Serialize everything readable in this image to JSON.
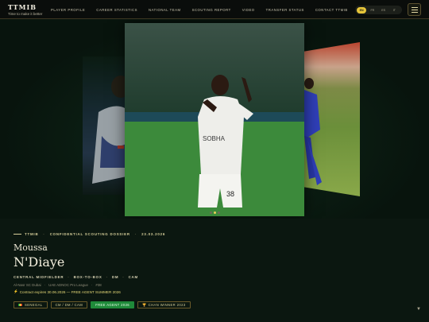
{
  "brand": {
    "title": "TTMIB",
    "tagline": "Time to make it better"
  },
  "nav": [
    {
      "label": "PLAYER PROFILE"
    },
    {
      "label": "CAREER STATISTICS"
    },
    {
      "label": "NATIONAL TEAM"
    },
    {
      "label": "SCOUTING REPORT"
    },
    {
      "label": "VIDEO"
    },
    {
      "label": "TRANSFER STATUS"
    },
    {
      "label": "CONTACT TTMIB"
    }
  ],
  "languages": [
    {
      "code": "EN",
      "active": true
    },
    {
      "code": "FR",
      "active": false
    },
    {
      "code": "ES",
      "active": false
    },
    {
      "code": "IT",
      "active": false
    }
  ],
  "menu_icon": "hamburger-icon",
  "carousel": {
    "slide_count": 3,
    "active_index": 1
  },
  "dossier": {
    "brand": "TTMIB",
    "label": "CONFIDENTIAL SCOUTING DOSSIER",
    "date": "23.03.2026",
    "first_name": "Moussa",
    "last_name": "N'Diaye",
    "roles": [
      "CENTRAL MIDFIELDER",
      "BOX-TO-BOX",
      "DM",
      "CAM"
    ],
    "club": "Al-Nasr SC Dubai",
    "league": "UAE ADNOC Pro League",
    "number": "#38",
    "contract_note": "Contract expires 30.06.2026 — FREE AGENT SUMMER 2026"
  },
  "badges": [
    {
      "label": "SENEGAL",
      "style": "flag"
    },
    {
      "label": "CM / DM / CAM",
      "style": "outline"
    },
    {
      "label": "FREE AGENT 2026",
      "style": "green"
    },
    {
      "label": "CHAN WINNER 2023",
      "style": "trophy"
    }
  ],
  "colors": {
    "accent": "#e7c63a",
    "background": "#0b1710",
    "green_badge": "#1f8a3a"
  }
}
